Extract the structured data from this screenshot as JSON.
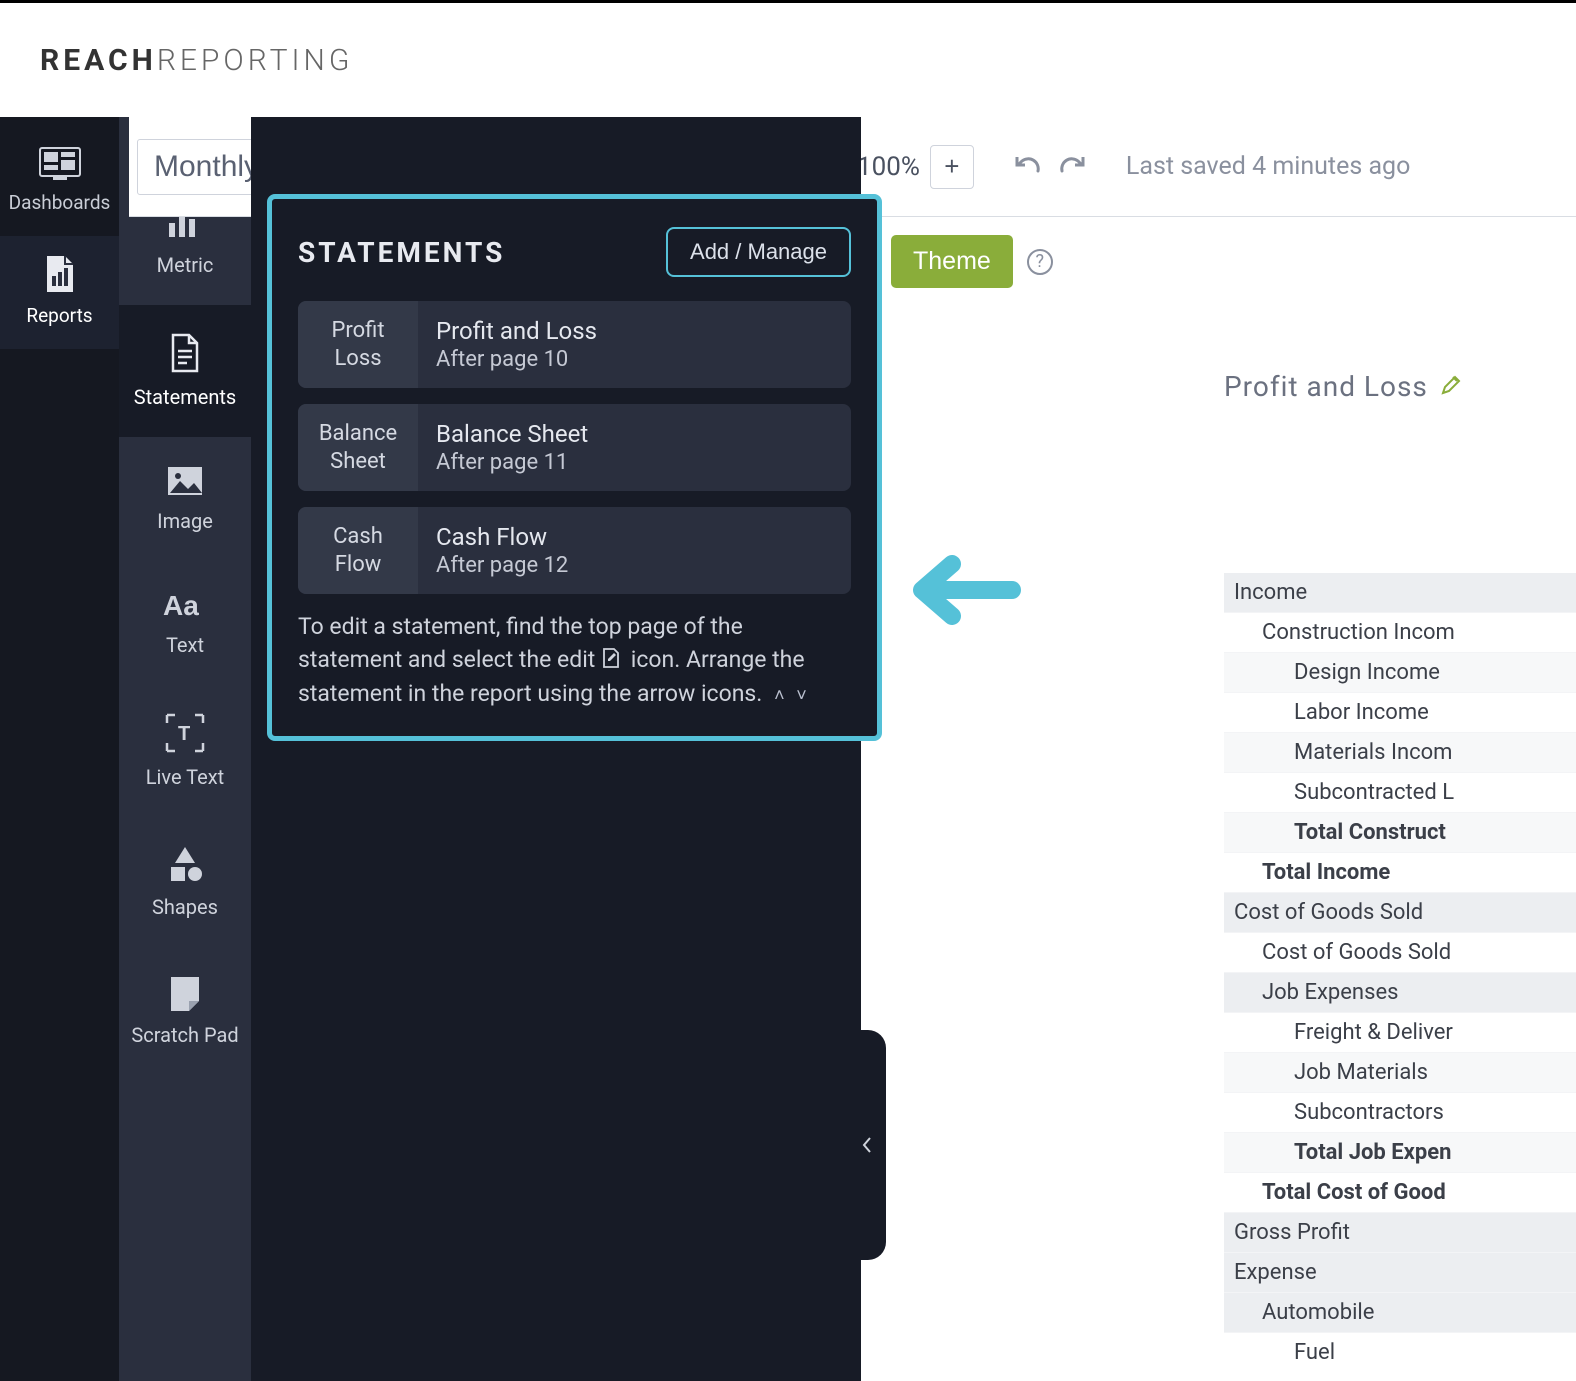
{
  "brand": {
    "bold": "REACH",
    "thin": "REPORTING"
  },
  "sidebar_primary": {
    "items": [
      {
        "label": "Dashboards"
      },
      {
        "label": "Reports"
      }
    ]
  },
  "sidebar_secondary": {
    "items": [
      {
        "label": "Metric"
      },
      {
        "label": "Statements"
      },
      {
        "label": "Image"
      },
      {
        "label": "Text"
      },
      {
        "label": "Live Text"
      },
      {
        "label": "Shapes"
      },
      {
        "label": "Scratch Pad"
      }
    ]
  },
  "toolbar": {
    "title": "Monthly Financial Report",
    "zoom": "100%",
    "last_saved": "Last saved 4 minutes ago",
    "theme_label": "Theme"
  },
  "statements": {
    "heading": "STATEMENTS",
    "add_manage": "Add / Manage",
    "cards": [
      {
        "badge_line1": "Profit",
        "badge_line2": "Loss",
        "name": "Profit and Loss",
        "sub": "After page 10"
      },
      {
        "badge_line1": "Balance",
        "badge_line2": "Sheet",
        "name": "Balance Sheet",
        "sub": "After page 11"
      },
      {
        "badge_line1": "Cash",
        "badge_line2": "Flow",
        "name": "Cash Flow",
        "sub": "After page 12"
      }
    ],
    "help": "To edit a statement, find the top page of the statement and select the edit",
    "help_tail": "icon. Arrange the statement in the report using the arrow icons."
  },
  "report": {
    "title": "Profit and Loss",
    "rows": [
      {
        "text": "Income",
        "cls": "h0 grey"
      },
      {
        "text": "Construction Incom",
        "cls": "h1"
      },
      {
        "text": "Design Income",
        "cls": "h2"
      },
      {
        "text": "Labor Income",
        "cls": "h2b"
      },
      {
        "text": "Materials Incom",
        "cls": "h2"
      },
      {
        "text": "Subcontracted L",
        "cls": "h2b"
      },
      {
        "text": "Total Construct",
        "cls": "h2 bold"
      },
      {
        "text": "Total Income",
        "cls": "h1 bold"
      },
      {
        "text": "Cost of Goods Sold",
        "cls": "h0 grey"
      },
      {
        "text": "Cost of Goods Sold",
        "cls": "h1"
      },
      {
        "text": "Job Expenses",
        "cls": "h1 grey"
      },
      {
        "text": "Freight & Deliver",
        "cls": "h2b"
      },
      {
        "text": "Job Materials",
        "cls": "h2"
      },
      {
        "text": "Subcontractors",
        "cls": "h2b"
      },
      {
        "text": "Total Job Expen",
        "cls": "h2 bold"
      },
      {
        "text": "Total Cost of Good",
        "cls": "h1 bold"
      },
      {
        "text": "Gross Profit",
        "cls": "h0"
      },
      {
        "text": "Expense",
        "cls": "h0"
      },
      {
        "text": "Automobile",
        "cls": "h1 grey"
      },
      {
        "text": "Fuel",
        "cls": "h2b noborder"
      }
    ]
  }
}
